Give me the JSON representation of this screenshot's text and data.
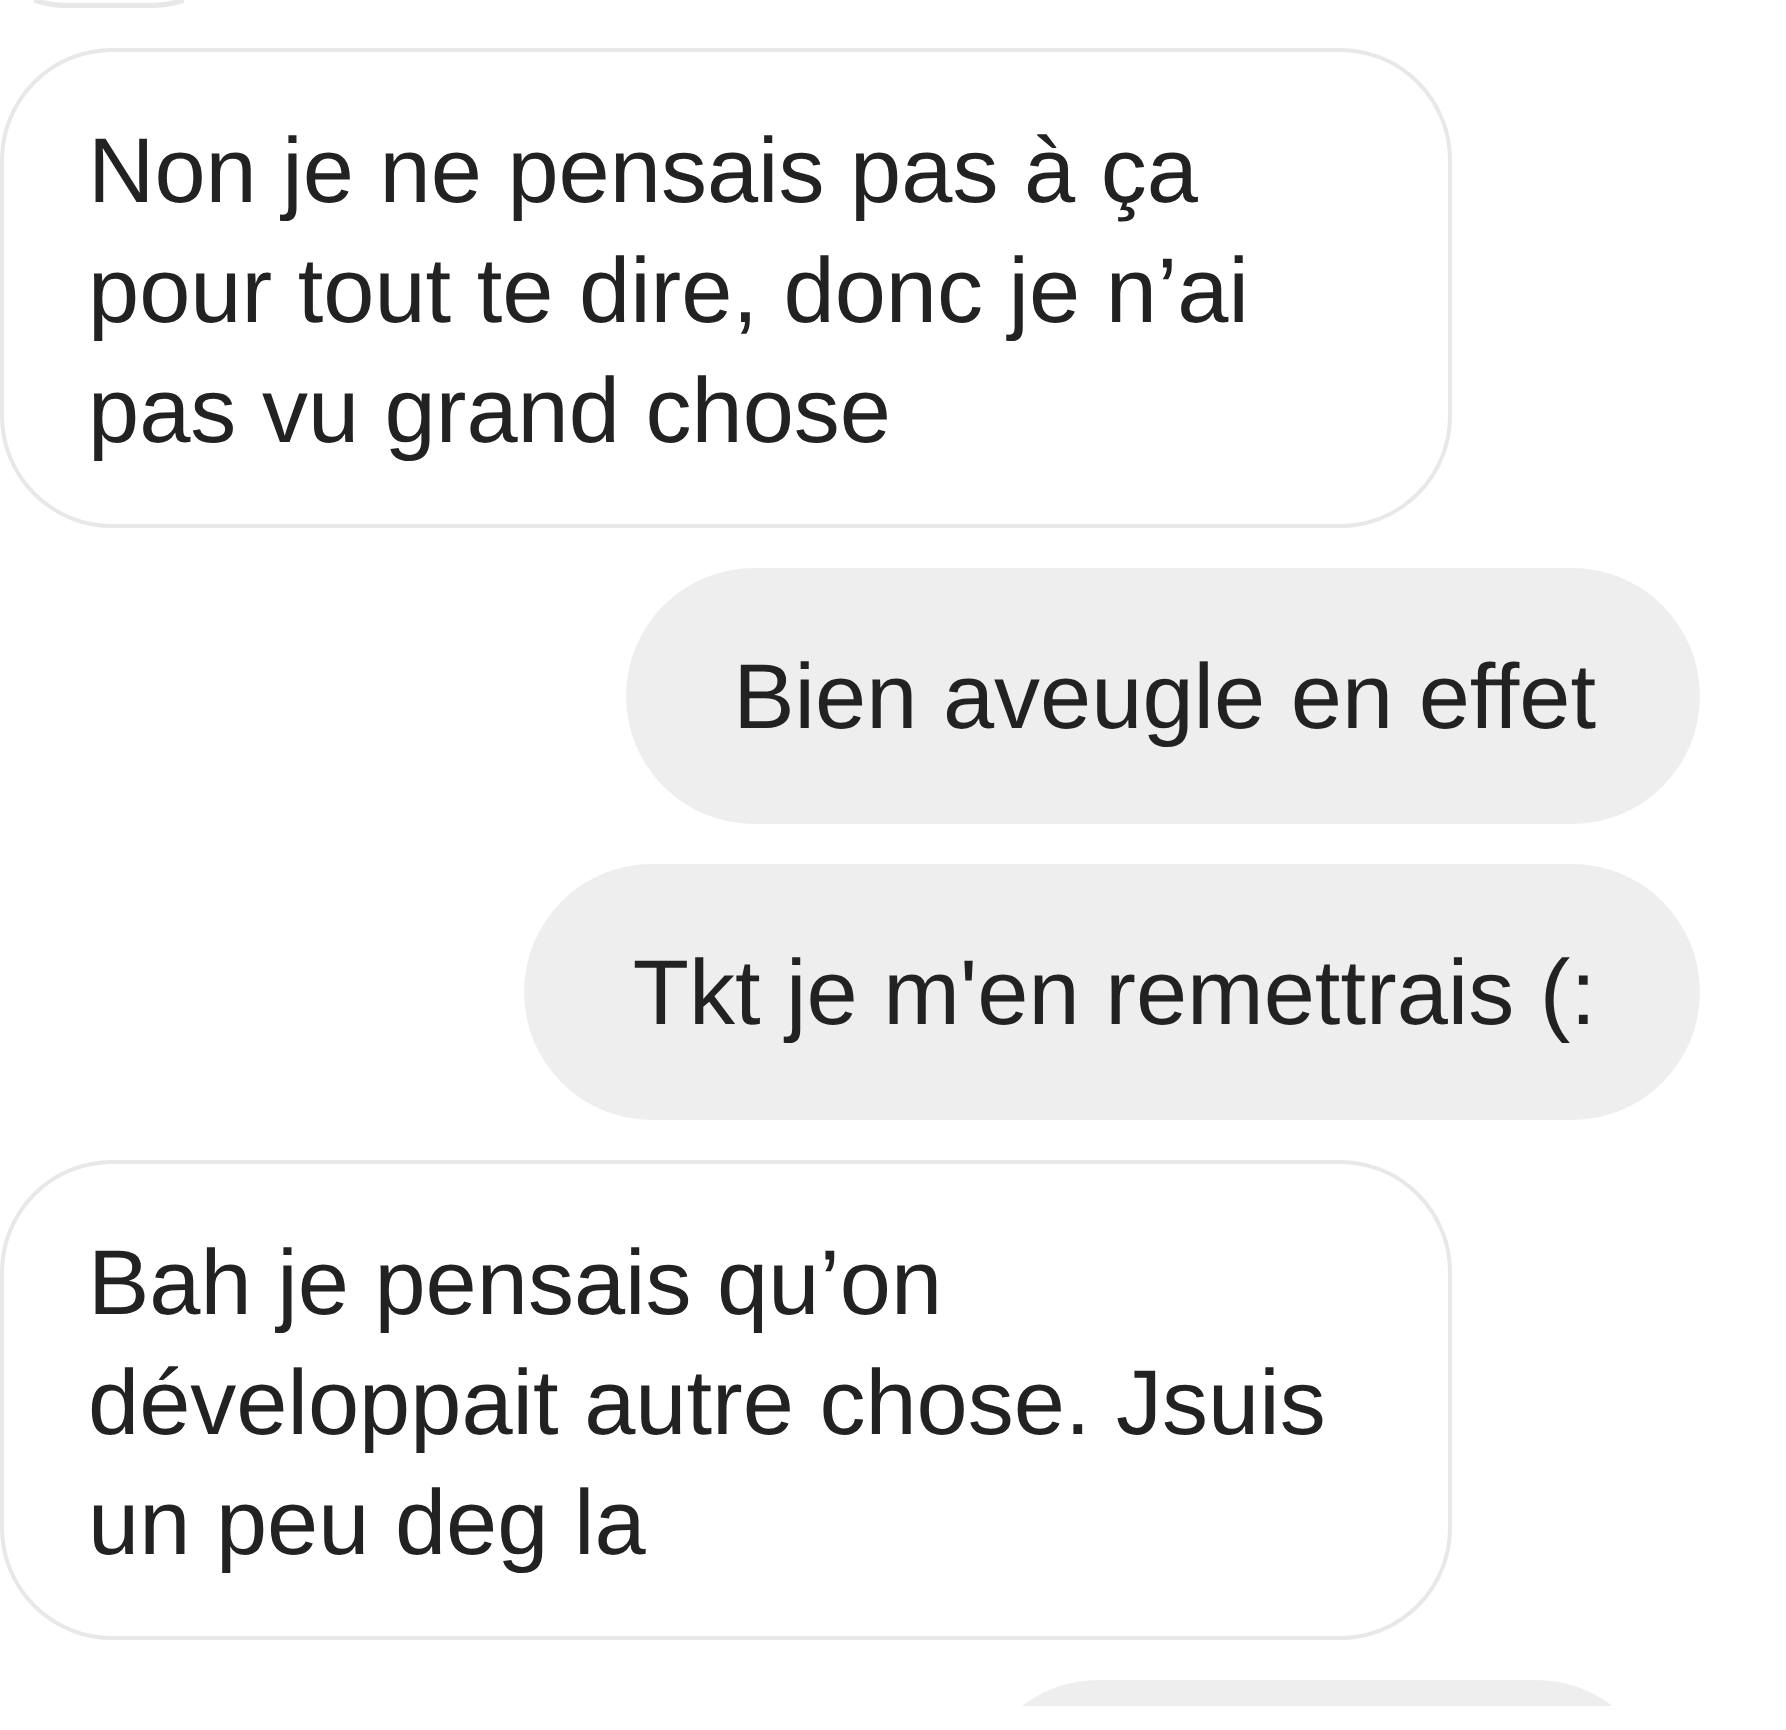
{
  "conversation": {
    "messages": [
      {
        "kind": "received",
        "cut_top": true
      },
      {
        "kind": "received",
        "text": "Non je ne pensais pas à ça pour tout te dire, donc je n’ai pas vu grand chose"
      },
      {
        "kind": "sent",
        "text": "Bien aveugle en effet"
      },
      {
        "kind": "sent",
        "text": "Tkt je m'en remettrais (:"
      },
      {
        "kind": "received",
        "text": "Bah je pensais qu’on développait autre chose. Jsuis un peu deg la"
      },
      {
        "kind": "sent",
        "cut_bottom": true
      }
    ]
  }
}
